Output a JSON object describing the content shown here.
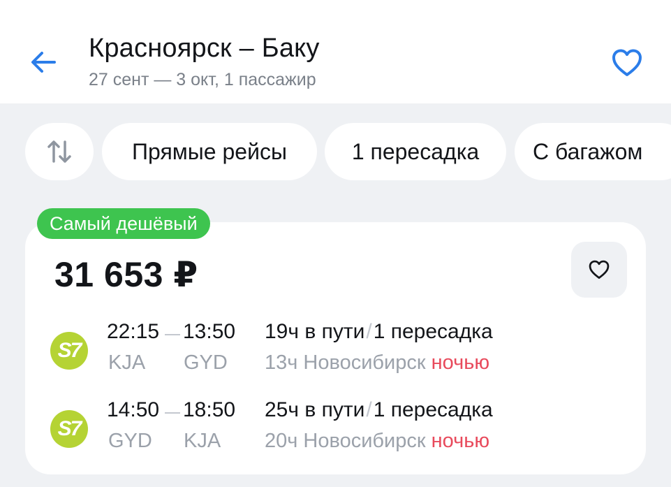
{
  "header": {
    "title": "Красноярск – Баку",
    "subtitle": "27 сент — 3 окт, 1 пассажир"
  },
  "filters": {
    "chips": [
      "Прямые рейсы",
      "1 пересадка",
      "С багажом"
    ]
  },
  "result": {
    "badge": "Самый дешёвый",
    "price": "31 653 ₽",
    "segments": [
      {
        "airline_logo": "S7",
        "dep_time": "22:15",
        "arr_time": "13:50",
        "dep_code": "KJA",
        "arr_code": "GYD",
        "duration": "19ч в пути",
        "transfers": "1 пересадка",
        "layover": "13ч Новосибирск",
        "layover_note": "ночью"
      },
      {
        "airline_logo": "S7",
        "dep_time": "14:50",
        "arr_time": "18:50",
        "dep_code": "GYD",
        "arr_code": "KJA",
        "duration": "25ч в пути",
        "transfers": "1 пересадка",
        "layover": "20ч Новосибирск",
        "layover_note": "ночью"
      }
    ]
  },
  "colors": {
    "accent": "#2b7de9",
    "badge": "#3ec44f",
    "night": "#e84a5c",
    "logo": "#b5d334"
  },
  "icons": {
    "back": "arrow-left-icon",
    "favorite": "heart-icon",
    "sort": "sort-arrows-icon"
  }
}
